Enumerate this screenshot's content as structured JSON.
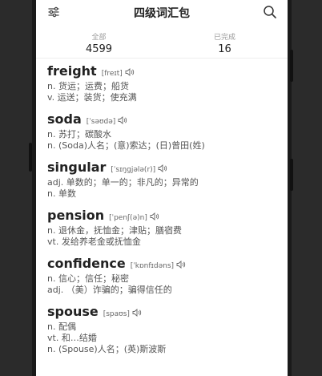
{
  "header": {
    "title": "四级词汇包"
  },
  "stats": [
    {
      "label": "全部",
      "value": "4599"
    },
    {
      "label": "已完成",
      "value": "16"
    }
  ],
  "words": [
    {
      "word": "freight",
      "phonetic": "[freɪt]",
      "defs": [
        "n. 货运；运费；船货",
        "v. 运送；装货；使充满"
      ]
    },
    {
      "word": "soda",
      "phonetic": "[ˈsəʊdə]",
      "defs": [
        "n. 苏打；碳酸水",
        "n. (Soda)人名；(意)索达；(日)曾田(姓)"
      ]
    },
    {
      "word": "singular",
      "phonetic": "[ˈsɪŋɡjələ(r)]",
      "defs": [
        "adj. 单数的；单一的；非凡的；异常的",
        "n. 单数"
      ]
    },
    {
      "word": "pension",
      "phonetic": "[ˈpenʃ(ə)n]",
      "defs": [
        "n. 退休金，抚恤金；津贴；膳宿费",
        "vt. 发给养老金或抚恤金"
      ]
    },
    {
      "word": "confidence",
      "phonetic": "[ˈkɒnfɪdəns]",
      "defs": [
        "n. 信心；信任；秘密",
        "adj. （美）诈骗的；骗得信任的"
      ]
    },
    {
      "word": "spouse",
      "phonetic": "[spaʊs]",
      "defs": [
        "n. 配偶",
        "vt. 和…结婚",
        "n. (Spouse)人名；(英)斯波斯"
      ]
    }
  ]
}
